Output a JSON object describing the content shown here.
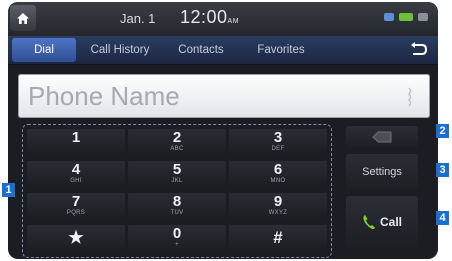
{
  "status": {
    "date": "Jan. 1",
    "time": "12:00",
    "ampm": "AM"
  },
  "tabs": [
    {
      "label": "Dial",
      "active": true
    },
    {
      "label": "Call History",
      "active": false
    },
    {
      "label": "Contacts",
      "active": false
    },
    {
      "label": "Favorites",
      "active": false
    }
  ],
  "name_field": {
    "placeholder": "Phone Name"
  },
  "keypad": {
    "keys": [
      {
        "digit": "1",
        "letters": ""
      },
      {
        "digit": "2",
        "letters": "ABC"
      },
      {
        "digit": "3",
        "letters": "DEF"
      },
      {
        "digit": "4",
        "letters": "GHI"
      },
      {
        "digit": "5",
        "letters": "JKL"
      },
      {
        "digit": "6",
        "letters": "MNO"
      },
      {
        "digit": "7",
        "letters": "PQRS"
      },
      {
        "digit": "8",
        "letters": "TUV"
      },
      {
        "digit": "9",
        "letters": "WXYZ"
      },
      {
        "digit": "★",
        "letters": ""
      },
      {
        "digit": "0",
        "letters": "+"
      },
      {
        "digit": "#",
        "letters": ""
      }
    ]
  },
  "side": {
    "settings_label": "Settings",
    "call_label": "Call"
  },
  "callouts": {
    "keypad": "1",
    "delete": "2",
    "settings": "3",
    "call": "4"
  },
  "colors": {
    "accent": "#4e74c3",
    "callout": "#1b6fd0",
    "call_icon": "#7ccf2e"
  }
}
